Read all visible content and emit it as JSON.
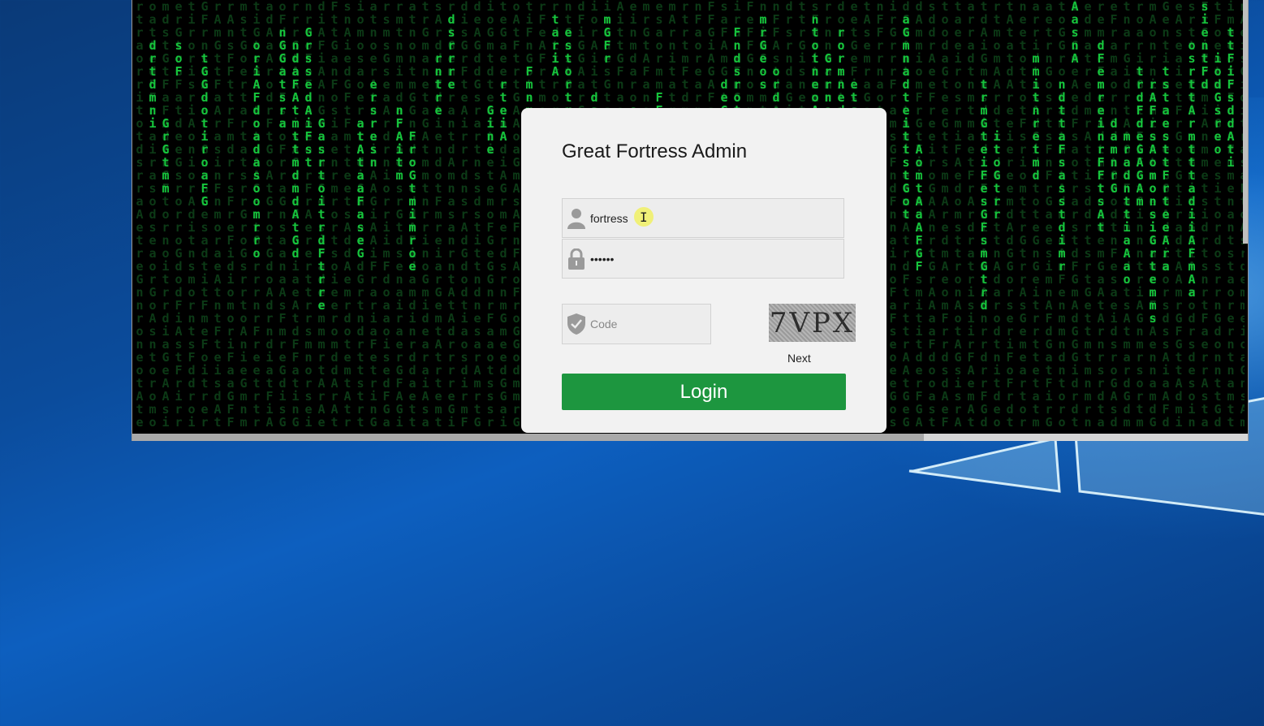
{
  "login": {
    "title": "Great Fortress Admin",
    "username": "fortress",
    "password_mask": "••••••",
    "code_placeholder": "Code",
    "captcha_text": "7VPX",
    "next_label": "Next",
    "login_label": "Login"
  },
  "icons": {
    "username": "user-icon",
    "password": "lock-icon",
    "code": "shield-check-icon"
  },
  "colors": {
    "accent": "#1d963f",
    "matrix_green": "#16c43c",
    "card_bg": "#f2f2f2"
  }
}
